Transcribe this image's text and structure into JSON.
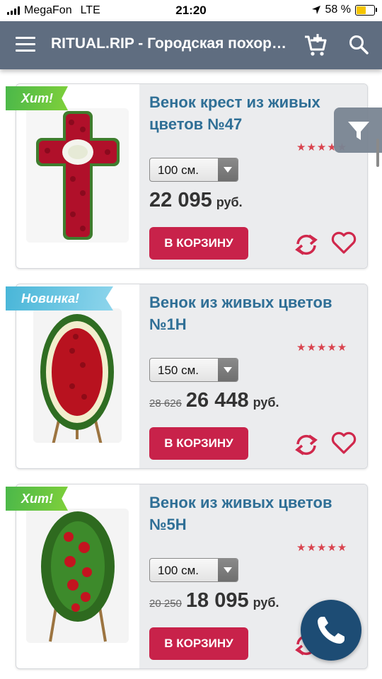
{
  "status_bar": {
    "carrier": "MegaFon",
    "network": "LTE",
    "time": "21:20",
    "battery": "58 %",
    "battery_level": 0.58
  },
  "header": {
    "title": "RITUAL.RIP - Городская похоронная служба",
    "menu_icon": "hamburger-menu-icon",
    "cart_icon": "cart-add-icon",
    "search_icon": "search-icon",
    "bg_color": "#5f6d80"
  },
  "filter_icon": "filter-icon",
  "products": [
    {
      "badge": "Хит!",
      "badge_color": "green",
      "name": "Венок крест из живых цветов №47",
      "rating": "★★★★★",
      "rating_value": 5,
      "size": "100 см.",
      "old_price": "",
      "price": "22 095",
      "currency": "руб.",
      "cart_label": "В КОРЗИНУ"
    },
    {
      "badge": "Новинка!",
      "badge_color": "blue",
      "name": "Венок из живых цветов №1Н",
      "rating": "★★★★★",
      "rating_value": 5,
      "size": "150 см.",
      "old_price": "28 626",
      "price": "26 448",
      "currency": "руб.",
      "cart_label": "В КОРЗИНУ"
    },
    {
      "badge": "Хит!",
      "badge_color": "green",
      "name": "Венок из живых цветов №5Н",
      "rating": "★★★★★",
      "rating_value": 5,
      "size": "100 см.",
      "old_price": "20 250",
      "price": "18 095",
      "currency": "руб.",
      "cart_label": "В КОРЗИНУ"
    }
  ],
  "colors": {
    "accent": "#c8224a",
    "title_blue": "#2f6f96",
    "call_button": "#1d4c74"
  },
  "call_icon": "phone-icon"
}
